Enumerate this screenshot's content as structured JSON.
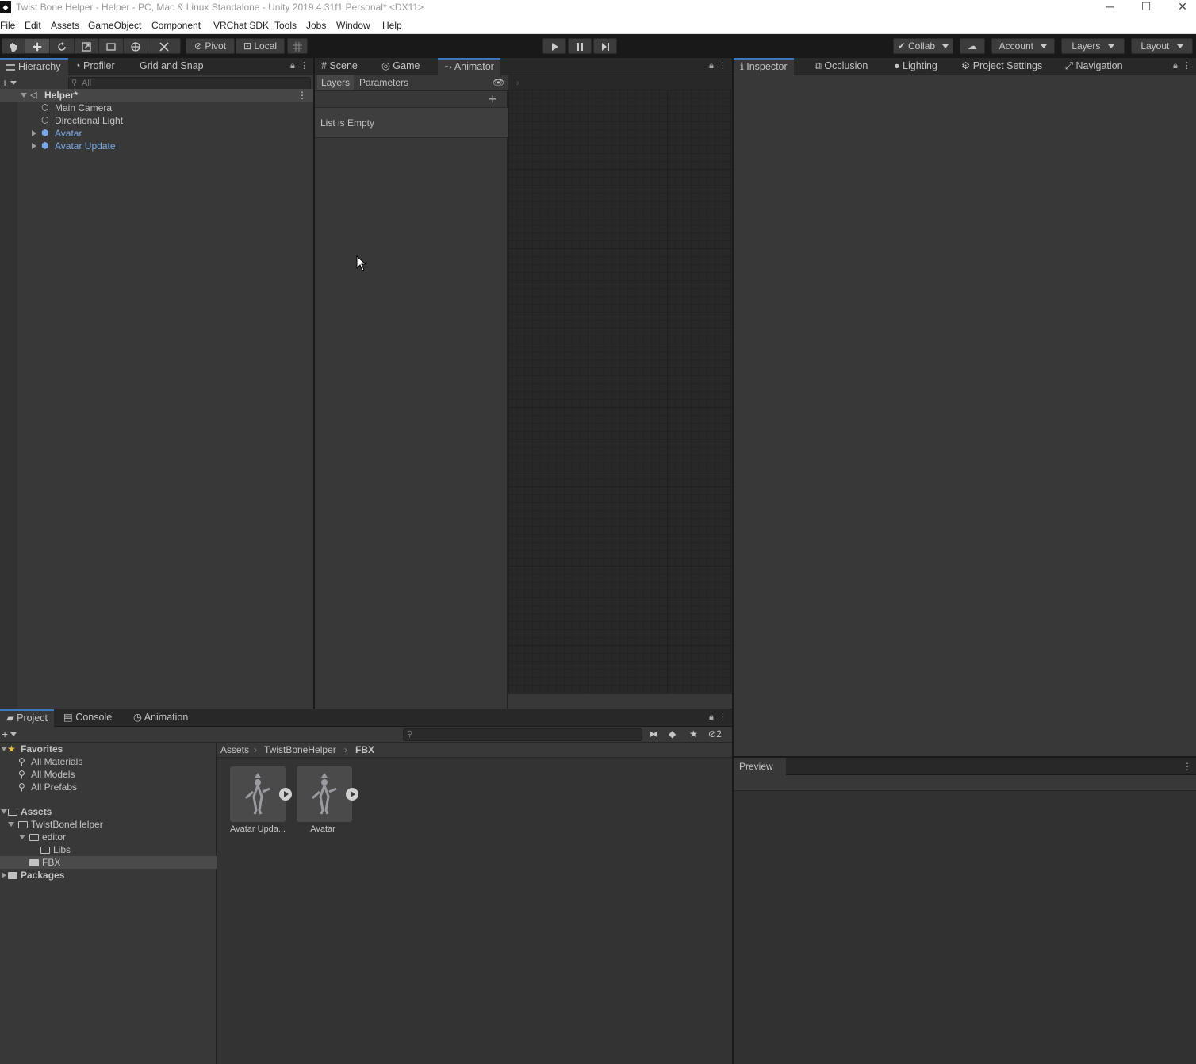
{
  "window": {
    "title": "Twist Bone Helper - Helper - PC, Mac & Linux Standalone - Unity 2019.4.31f1 Personal* <DX11>",
    "minimize": "─",
    "maximize": "☐",
    "close": "✕"
  },
  "menu": [
    "File",
    "Edit",
    "Assets",
    "GameObject",
    "Component",
    "VRChat SDK",
    "Tools",
    "Jobs",
    "Window",
    "Help"
  ],
  "toolbar": {
    "pivot": "Pivot",
    "local": "Local",
    "collab": "Collab",
    "account": "Account",
    "layers": "Layers",
    "layout": "Layout"
  },
  "hierarchy": {
    "tabs": [
      "Hierarchy",
      "Profiler",
      "Grid and Snap"
    ],
    "search_placeholder": "All",
    "scene": "Helper*",
    "items": [
      "Main Camera",
      "Directional Light",
      "Avatar",
      "Avatar Update"
    ]
  },
  "center": {
    "tabs": [
      "Scene",
      "Game",
      "Animator"
    ],
    "subtabs": [
      "Layers",
      "Parameters"
    ],
    "empty_text": "List is Empty"
  },
  "inspector": {
    "tabs": [
      "Inspector",
      "Occlusion",
      "Lighting",
      "Project Settings",
      "Navigation"
    ]
  },
  "bottom": {
    "tabs": [
      "Project",
      "Console",
      "Animation"
    ],
    "hidden_count": "2",
    "favorites": {
      "label": "Favorites",
      "items": [
        "All Materials",
        "All Models",
        "All Prefabs"
      ]
    },
    "assets_tree": {
      "assets": "Assets",
      "twist": "TwistBoneHelper",
      "editor": "editor",
      "libs": "Libs",
      "fbx": "FBX",
      "packages": "Packages"
    },
    "breadcrumb": [
      "Assets",
      "TwistBoneHelper",
      "FBX"
    ],
    "files": [
      "Avatar Upda...",
      "Avatar"
    ]
  },
  "preview": {
    "label": "Preview"
  }
}
